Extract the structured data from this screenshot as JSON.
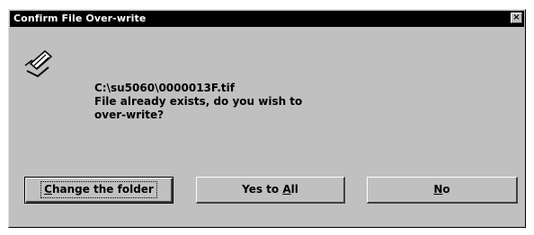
{
  "dialog": {
    "title": "Confirm File Over-write",
    "close_glyph": "×",
    "icon": "warning-icon",
    "message": {
      "path": "C:\\su5060\\0000013F.tif",
      "line2": "File already exists, do you wish to",
      "line3": "over-write?"
    },
    "buttons": {
      "change_folder": {
        "mnemonic": "C",
        "rest": "hange the folder"
      },
      "yes_to_all": {
        "pre": "Yes to ",
        "mnemonic": "A",
        "rest": "ll"
      },
      "no": {
        "mnemonic": "N",
        "rest": "o"
      }
    }
  }
}
